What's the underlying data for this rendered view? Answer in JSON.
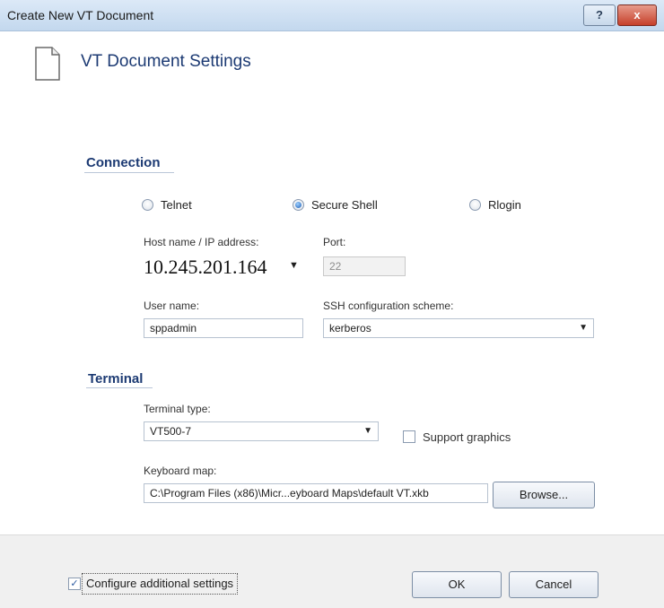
{
  "window": {
    "title": "Create New VT Document",
    "help_label": "?",
    "close_label": "x"
  },
  "header": {
    "title": "VT Document Settings",
    "icon": "document-icon"
  },
  "connection": {
    "section_title": "Connection",
    "radios": [
      {
        "label": "Telnet",
        "selected": false
      },
      {
        "label": "Secure Shell",
        "selected": true
      },
      {
        "label": "Rlogin",
        "selected": false
      }
    ],
    "host_label": "Host name / IP address:",
    "host_value": "10.245.201.164",
    "port_label": "Port:",
    "port_value": "22",
    "user_label": "User name:",
    "user_value": "sppadmin",
    "ssh_label": "SSH configuration scheme:",
    "ssh_value": "kerberos"
  },
  "terminal": {
    "section_title": "Terminal",
    "type_label": "Terminal type:",
    "type_value": "VT500-7",
    "support_graphics_label": "Support graphics",
    "support_graphics_checked": false,
    "keyboard_label": "Keyboard map:",
    "keyboard_value": "C:\\Program Files (x86)\\Micr...eyboard Maps\\default VT.xkb",
    "browse_label": "Browse..."
  },
  "footer": {
    "configure_label": "Configure additional settings",
    "configure_checked": true,
    "ok_label": "OK",
    "cancel_label": "Cancel"
  },
  "colors": {
    "accent": "#1c3a73",
    "close": "#c6402a"
  }
}
